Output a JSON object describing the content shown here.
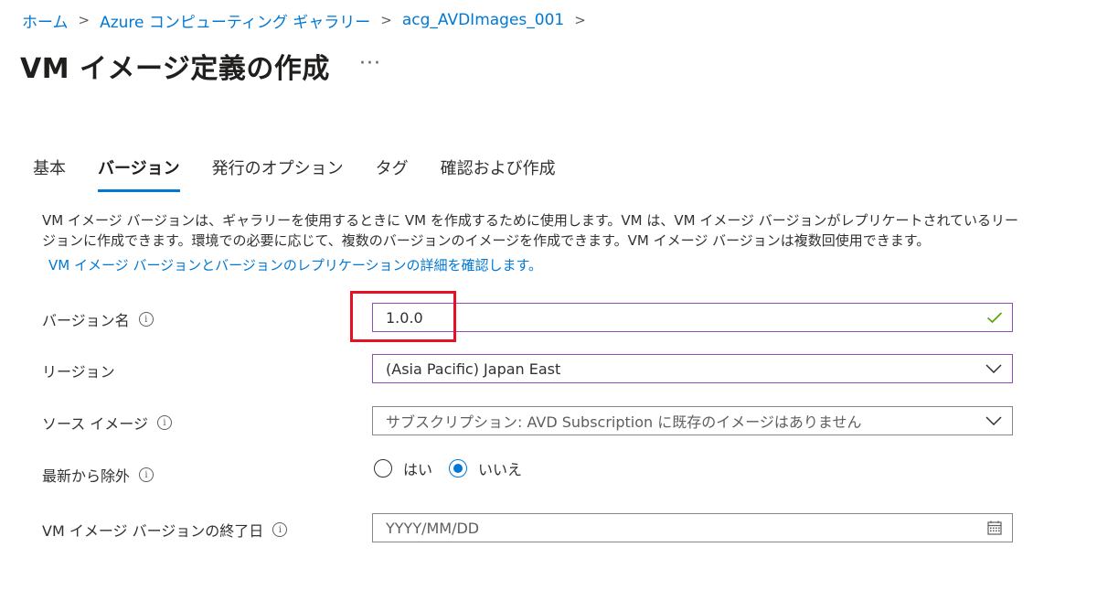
{
  "breadcrumb": {
    "items": [
      "ホーム",
      "Azure コンピューティング ギャラリー",
      "acg_AVDImages_001"
    ],
    "separator": ">"
  },
  "page": {
    "title": "VM イメージ定義の作成",
    "more": "···"
  },
  "tabs": [
    {
      "label": "基本",
      "active": false
    },
    {
      "label": "バージョン",
      "active": true
    },
    {
      "label": "発行のオプション",
      "active": false
    },
    {
      "label": "タグ",
      "active": false
    },
    {
      "label": "確認および作成",
      "active": false
    }
  ],
  "description": {
    "text": "VM イメージ バージョンは、ギャラリーを使用するときに VM を作成するために使用します。VM は、VM イメージ バージョンがレプリケートされているリージョンに作成できます。環境での必要に応じて、複数のバージョンのイメージを作成できます。VM イメージ バージョンは複数回使用できます。",
    "link": "VM イメージ バージョンとバージョンのレプリケーションの詳細を確認します。"
  },
  "form": {
    "version_name": {
      "label": "バージョン名",
      "value": "1.0.0",
      "info_icon": "i"
    },
    "region": {
      "label": "リージョン",
      "value": "(Asia Pacific) Japan East"
    },
    "source_image": {
      "label": "ソース イメージ",
      "value": "サブスクリプション: AVD Subscription に既存のイメージはありません",
      "info_icon": "i"
    },
    "exclude_latest": {
      "label": "最新から除外",
      "info_icon": "i",
      "options": [
        "はい",
        "いいえ"
      ],
      "selected": "いいえ"
    },
    "end_date": {
      "label": "VM イメージ バージョンの終了日",
      "placeholder": "YYYY/MM/DD",
      "info_icon": "i"
    }
  },
  "colors": {
    "accent": "#0078d4",
    "valid_check": "#57a300",
    "focus_border": "#8a4fb0",
    "highlight": "#e81123"
  },
  "icons": {
    "breadcrumb_sep": "chevron-right-icon",
    "more": "ellipsis-icon",
    "info": "info-icon",
    "valid": "checkmark-icon",
    "dropdown": "chevron-down-icon",
    "calendar": "calendar-icon"
  }
}
